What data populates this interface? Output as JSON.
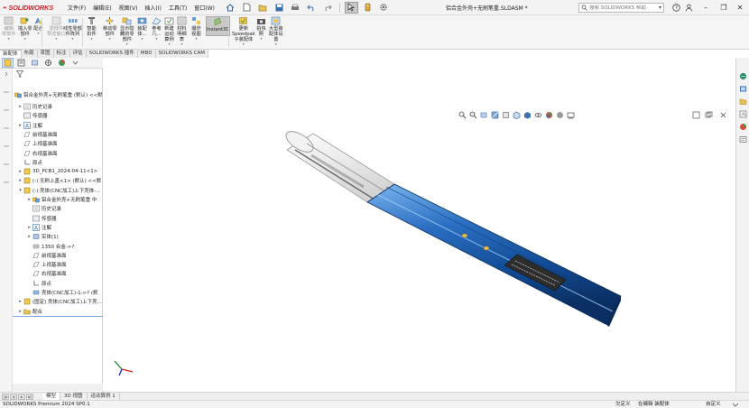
{
  "app": {
    "logo_text": "SOLIDWORKS",
    "document_title": "铝合金外壳+无刷笔重.SLDASM *",
    "brand_color": "#d2232a"
  },
  "menu": [
    "文件(F)",
    "编辑(E)",
    "视图(V)",
    "插入(I)",
    "工具(T)",
    "窗口(W)"
  ],
  "quick_access_icons": [
    "home-icon",
    "new-document-icon",
    "open-icon",
    "save-icon",
    "print-icon",
    "undo-icon",
    "redo-icon",
    "select-arrow-icon",
    "rebuild-icon",
    "options-gear-icon"
  ],
  "search": {
    "placeholder": "搜索 SOLIDWORKS 帮助"
  },
  "ribbon": [
    {
      "label": "编辑\n零部件",
      "icon": "edit-component-icon",
      "dim": true
    },
    {
      "label": "插入零\n部件",
      "icon": "insert-component-icon",
      "dim": false
    },
    {
      "label": "配合",
      "icon": "mate-icon",
      "dim": false
    },
    {
      "label": "零部件\n预览窗口",
      "icon": "component-preview-icon",
      "dim": true
    },
    {
      "label": "线性零部\n件阵列",
      "icon": "linear-pattern-icon",
      "dim": false
    },
    {
      "label": "智能\n扣件",
      "icon": "smart-fasteners-icon",
      "dim": false
    },
    {
      "label": "移动零\n部件",
      "icon": "move-component-icon",
      "dim": false
    },
    {
      "label": "显示隐\n藏的零\n部件",
      "icon": "show-hidden-icon",
      "dim": false
    },
    {
      "label": "装配\n体...",
      "icon": "assembly-features-icon",
      "dim": false
    },
    {
      "label": "参考\n几...",
      "icon": "reference-geometry-icon",
      "dim": false
    },
    {
      "label": "新建\n运动\n算例",
      "icon": "new-motion-study-icon",
      "dim": false
    },
    {
      "label": "材料\n明细\n表",
      "icon": "bom-icon",
      "dim": false
    },
    {
      "label": "爆炸\n视图",
      "icon": "exploded-view-icon",
      "dim": false
    },
    {
      "label": "Instant3D",
      "icon": "instant3d-icon",
      "dim": false,
      "active": true
    },
    {
      "label": "更新\nSpeedpak\n子装配体",
      "icon": "speedpak-icon",
      "dim": false
    },
    {
      "label": "拍快\n照",
      "icon": "snapshot-icon",
      "dim": false
    },
    {
      "label": "大型装\n配体设\n置",
      "icon": "large-assembly-icon",
      "dim": false
    }
  ],
  "command_tabs": [
    "装配体",
    "布局",
    "草图",
    "标注",
    "评估",
    "SOLIDWORKS 插件",
    "MBD",
    "SOLIDWORKS CAM"
  ],
  "tree": {
    "root": "铝合金外壳+无刷笔重 (默认) <<默",
    "items": [
      {
        "label": "历史记录",
        "icon": "history-icon",
        "exp": "▸"
      },
      {
        "label": "传感器",
        "icon": "sensor-icon",
        "exp": ""
      },
      {
        "label": "注解",
        "icon": "annotation-icon",
        "exp": "▸"
      },
      {
        "label": "前视基准面",
        "icon": "plane-icon",
        "exp": ""
      },
      {
        "label": "上视基准面",
        "icon": "plane-icon",
        "exp": ""
      },
      {
        "label": "右视基准面",
        "icon": "plane-icon",
        "exp": ""
      },
      {
        "label": "原点",
        "icon": "origin-icon",
        "exp": ""
      },
      {
        "label": "3D_PCB1_2024-04-11<1>",
        "icon": "part-icon",
        "exp": "▸"
      },
      {
        "label": "(-) 无刷上盖<1> (默认) <<默",
        "icon": "part-icon",
        "exp": "▸"
      },
      {
        "label": "(-) 壳体(CNC加工)上下壳体-...",
        "icon": "part-icon",
        "exp": "▾"
      },
      {
        "label": "铝合金外壳+无刷笔重 中",
        "icon": "assembly-icon",
        "exp": "▸"
      },
      {
        "label": "历史记录",
        "icon": "history-icon",
        "exp": ""
      },
      {
        "label": "传感器",
        "icon": "sensor-icon",
        "exp": ""
      },
      {
        "label": "注解",
        "icon": "annotation-icon",
        "exp": "▸"
      },
      {
        "label": "实体(1)",
        "icon": "solid-bodies-icon",
        "exp": "▸"
      },
      {
        "label": "1350 合金->?",
        "icon": "material-icon",
        "exp": ""
      },
      {
        "label": "前视基准面",
        "icon": "plane-icon",
        "exp": ""
      },
      {
        "label": "上视基准面",
        "icon": "plane-icon",
        "exp": ""
      },
      {
        "label": "右视基准面",
        "icon": "plane-icon",
        "exp": ""
      },
      {
        "label": "原点",
        "icon": "origin-icon",
        "exp": ""
      },
      {
        "label": "壳体(CNC加工)-1->? (默",
        "icon": "feature-icon",
        "exp": ""
      },
      {
        "label": "(固定) 壳体(CNC加工)上下壳...",
        "icon": "part-icon",
        "exp": "▸"
      },
      {
        "label": "配合",
        "icon": "mates-folder-icon",
        "exp": "▸"
      }
    ]
  },
  "bottom_tabs": [
    "模型",
    "3D 视图",
    "运动算例 1"
  ],
  "status": {
    "left": "SOLIDWORKS Premium 2024 SP0.1",
    "undefined": "欠定义",
    "editing": "在编辑 装配体",
    "custom": "自定义"
  }
}
